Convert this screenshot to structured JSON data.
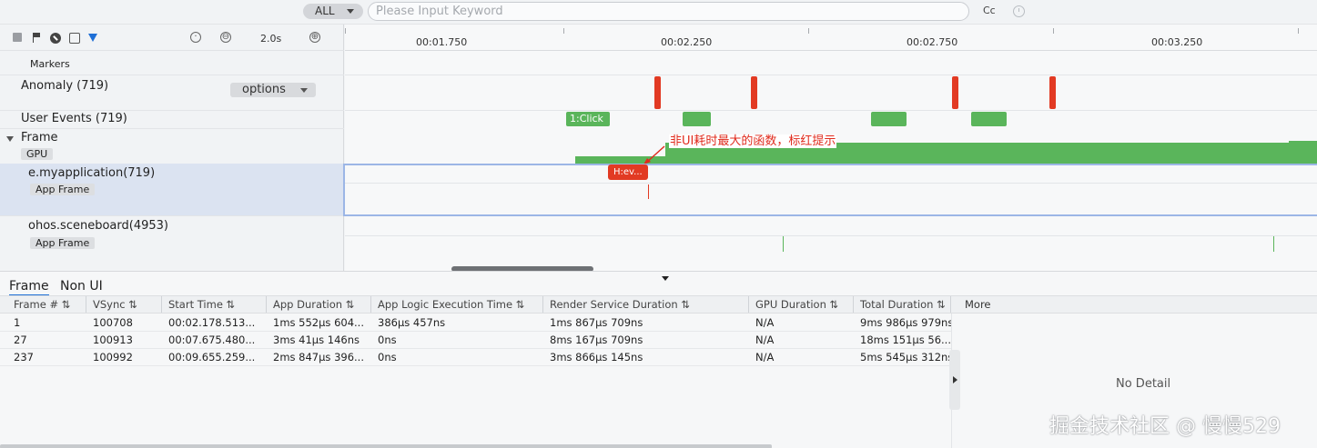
{
  "search": {
    "scope": "ALL",
    "placeholder": "Please Input Keyword",
    "case_btn": "Cc"
  },
  "toolbar": {
    "zoom_out_symbol": "⊖",
    "zoom_in_symbol": "⊕",
    "zoom_value": "2.0s"
  },
  "ruler": {
    "ticks": [
      "00:01.750",
      "00:02.250",
      "00:02.750",
      "00:03.250"
    ]
  },
  "rows": {
    "markers": "Markers",
    "anomaly": "Anomaly (719)",
    "options": "options",
    "user_events": "User Events (719)",
    "frame": "Frame",
    "gpu_tag": "GPU",
    "app1": "e.myapplication(719)",
    "app1_tag": "App Frame",
    "app2": "ohos.sceneboard(4953)",
    "app2_tag": "App Frame"
  },
  "timeline": {
    "click_label": "1:Click",
    "func_label": "H:ev...",
    "annotation": "非UI耗时最大的函数，标红提示",
    "colors": {
      "anomaly": "#e23a23",
      "event": "#5ab55b",
      "selection": "#9cb6e6",
      "accent": "#1f6fd6"
    }
  },
  "bottom": {
    "tabs": [
      "Frame",
      "Non UI"
    ],
    "columns": [
      "Frame # ⇅",
      "VSync ⇅",
      "Start Time ⇅",
      "App Duration ⇅",
      "App Logic Execution Time ⇅",
      "Render Service Duration ⇅",
      "GPU Duration ⇅",
      "Total Duration ⇅"
    ],
    "rows": [
      [
        "1",
        "100708",
        "00:02.178.513...",
        "1ms 552μs 604...",
        "386μs 457ns",
        "1ms 867μs 709ns",
        "N/A",
        "9ms 986μs 979ns"
      ],
      [
        "27",
        "100913",
        "00:07.675.480...",
        "3ms 41μs 146ns",
        "0ns",
        "8ms 167μs 709ns",
        "N/A",
        "18ms 151μs 56..."
      ],
      [
        "237",
        "100992",
        "00:09.655.259...",
        "2ms 847μs 396...",
        "0ns",
        "3ms 866μs 145ns",
        "N/A",
        "5ms 545μs 312ns"
      ]
    ],
    "more": "More",
    "no_detail": "No Detail",
    "watermark": "掘金技术社区 @ 慢慢529"
  }
}
